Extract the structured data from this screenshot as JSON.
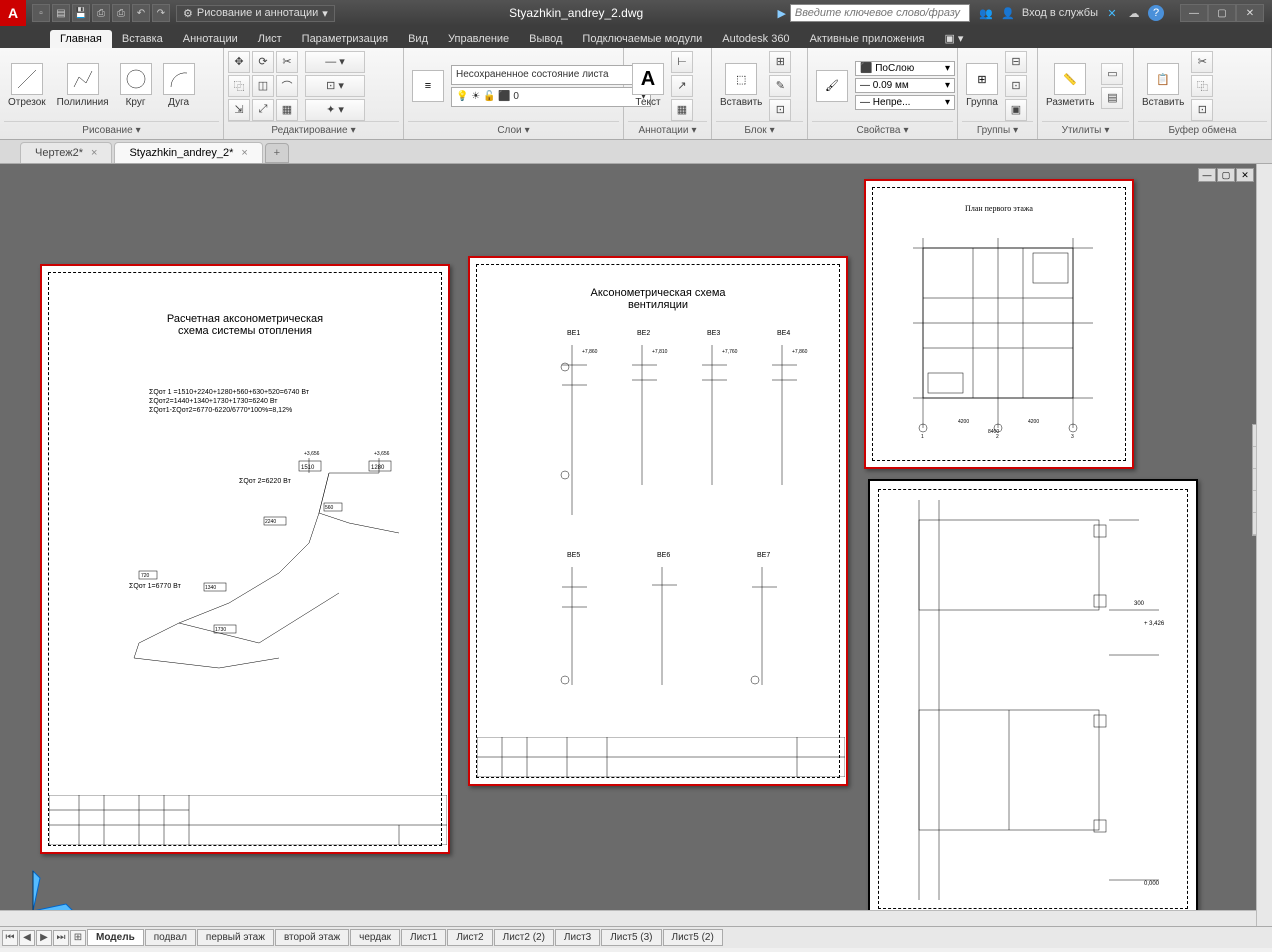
{
  "app": {
    "letter": "A",
    "title": "Styazhkin_andrey_2.dwg"
  },
  "workspace": {
    "label": "Рисование и аннотации"
  },
  "search": {
    "placeholder": "Введите ключевое слово/фразу"
  },
  "signin": "Вход в службы",
  "ribbon_tabs": [
    "Главная",
    "Вставка",
    "Аннотации",
    "Лист",
    "Параметризация",
    "Вид",
    "Управление",
    "Вывод",
    "Подключаемые модули",
    "Autodesk 360",
    "Активные приложения"
  ],
  "panels": {
    "draw": {
      "title": "Рисование",
      "line": "Отрезок",
      "pline": "Полилиния",
      "circle": "Круг",
      "arc": "Дуга"
    },
    "modify": {
      "title": "Редактирование"
    },
    "layers": {
      "title": "Слои",
      "unsaved": "Несохраненное состояние листа"
    },
    "annot": {
      "title": "Аннотации",
      "text": "Текст"
    },
    "block": {
      "title": "Блок",
      "insert": "Вставить"
    },
    "props": {
      "title": "Свойства",
      "bylayer": "ПоСлою",
      "lw": "0.09 мм",
      "lt": "Непре..."
    },
    "groups": {
      "title": "Группы",
      "group": "Группа"
    },
    "utils": {
      "title": "Утилиты",
      "measure": "Разметить"
    },
    "clip": {
      "title": "Буфер обмена",
      "paste": "Вставить"
    }
  },
  "file_tabs": {
    "t1": "Чертеж2*",
    "t2": "Styazhkin_andrey_2*"
  },
  "sheets": {
    "s1": {
      "title1": "Расчетная аксонометрическая",
      "title2": "схема системы отопления",
      "eq1": "ΣQот 1 =1510+2240+1280+560+630+520=6740 Вт",
      "eq2": "ΣQот2=1440+1340+1730+1730=6240 Вт",
      "eq3": "ΣQот1-ΣQот2=6770-6220/6770*100%=8,12%",
      "sum2": "ΣQот 2=6220 Вт",
      "sum1": "ΣQот 1=6770 Вт"
    },
    "s2": {
      "title1": "Аксонометрическая схема",
      "title2": "вентиляции",
      "be1": "ВЕ1",
      "be2": "ВЕ2",
      "be3": "ВЕ3",
      "be4": "ВЕ4",
      "be5": "ВЕ5",
      "be6": "ВЕ6",
      "be7": "ВЕ7"
    },
    "s3": {
      "title": "План первого этажа"
    }
  },
  "layout_tabs": [
    "Модель",
    "подвал",
    "первый этаж",
    "второй этаж",
    "чердак",
    "Лист1",
    "Лист2",
    "Лист2 (2)",
    "Лист3",
    "Лист5 (3)",
    "Лист5 (2)"
  ]
}
